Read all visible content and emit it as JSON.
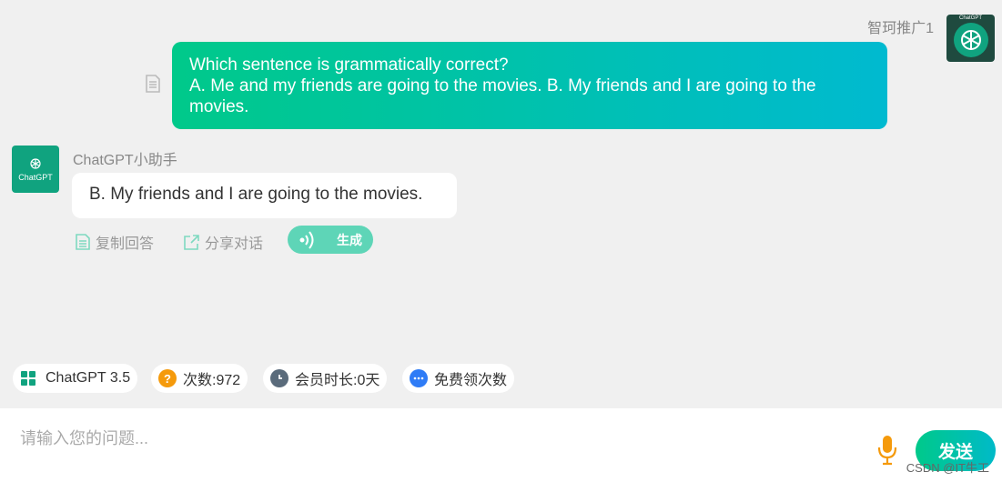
{
  "user": {
    "name": "智珂推广1",
    "avatar_label": "ChatGPT"
  },
  "messages": {
    "user_message_lines": [
      "Which sentence is grammatically correct?",
      "A. Me and my friends are going to the movies. B. My friends and I are going to the",
      "movies."
    ],
    "bot_name": "ChatGPT小助手",
    "bot_avatar_label": "ChatGPT",
    "bot_reply": "B. My friends and I are going to the movies."
  },
  "actions": {
    "copy": "复制回答",
    "share": "分享对话",
    "generate": "生成"
  },
  "chips": {
    "model": "ChatGPT 3.5",
    "count": "次数:972",
    "duration": "会员时长:0天",
    "free": "免费领次数"
  },
  "input": {
    "placeholder": "请输入您的问题...",
    "value": "",
    "send_label": "发送"
  },
  "watermark": "CSDN @IT牛工",
  "colors": {
    "accent": "#00c98a",
    "accent_end": "#00bad0",
    "brand": "#10a37f"
  }
}
